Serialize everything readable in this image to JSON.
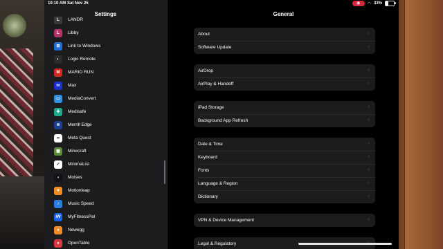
{
  "status_bar": {
    "time": "10:10 AM",
    "date": "Sat Nov 25",
    "battery": "33%",
    "battery_level": 0.33
  },
  "sidebar": {
    "title": "Settings",
    "items": [
      {
        "label": "LANDR",
        "icon": "landr-icon",
        "color": "#3a3a3c"
      },
      {
        "label": "Libby",
        "icon": "libby-icon",
        "color": "#b8336a"
      },
      {
        "label": "Link to Windows",
        "icon": "link-to-windows-icon",
        "color": "#1f6fd6"
      },
      {
        "label": "Logic Remote",
        "icon": "logic-remote-icon",
        "color": "#2b2b2e"
      },
      {
        "label": "MARIO RUN",
        "icon": "mario-run-icon",
        "color": "#d62b1f"
      },
      {
        "label": "Max",
        "icon": "max-icon",
        "color": "#1a2fd1"
      },
      {
        "label": "MediaConvert",
        "icon": "mediaconvert-icon",
        "color": "#2f8fe0"
      },
      {
        "label": "Medisafe",
        "icon": "medisafe-icon",
        "color": "#1ea98c"
      },
      {
        "label": "Merrill Edge",
        "icon": "merrill-edge-icon",
        "color": "#1c3f94"
      },
      {
        "label": "Meta Quest",
        "icon": "meta-quest-icon",
        "color": "#ffffff"
      },
      {
        "label": "Minecraft",
        "icon": "minecraft-icon",
        "color": "#5a8f3a"
      },
      {
        "label": "MinimaList",
        "icon": "minimalist-icon",
        "color": "#ffffff"
      },
      {
        "label": "Moises",
        "icon": "moises-icon",
        "color": "#101316"
      },
      {
        "label": "Motionleap",
        "icon": "motionleap-icon",
        "color": "#f08a24"
      },
      {
        "label": "Music Speed",
        "icon": "music-speed-icon",
        "color": "#2a7de1"
      },
      {
        "label": "MyFitnessPal",
        "icon": "myfitnesspal-icon",
        "color": "#1662e8"
      },
      {
        "label": "Newegg",
        "icon": "newegg-icon",
        "color": "#f28c28"
      },
      {
        "label": "OpenTable",
        "icon": "opentable-icon",
        "color": "#da3743"
      }
    ]
  },
  "detail": {
    "title": "General",
    "groups": [
      [
        "About",
        "Software Update"
      ],
      [
        "AirDrop",
        "AirPlay & Handoff"
      ],
      [
        "iPad Storage",
        "Background App Refresh"
      ],
      [
        "Date & Time",
        "Keyboard",
        "Fonts",
        "Language & Region",
        "Dictionary"
      ],
      [
        "VPN & Device Management"
      ],
      [
        "Legal & Regulatory"
      ]
    ]
  }
}
